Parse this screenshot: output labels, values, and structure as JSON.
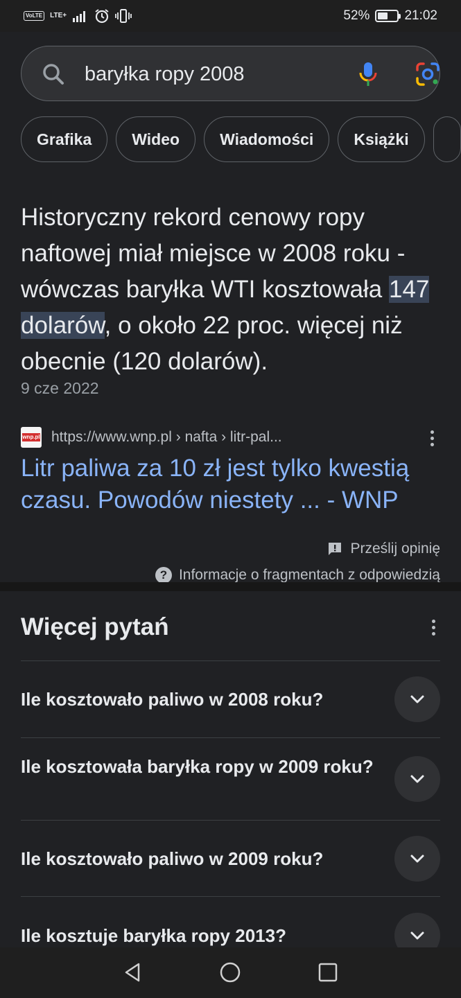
{
  "status_bar": {
    "volte": "VoLTE",
    "network": "LTE+",
    "battery_percent": "52%",
    "battery_level": 0.52,
    "time": "21:02"
  },
  "search": {
    "query": "baryłka ropy 2008",
    "icons": {
      "search": "search-icon",
      "mic": "mic-icon",
      "lens": "google-lens-icon"
    }
  },
  "chips": [
    "Grafika",
    "Wideo",
    "Wiadomości",
    "Książki"
  ],
  "snippet": {
    "answer_before": "Historyczny rekord cenowy ropy naftowej miał miejsce w 2008 roku - wówczas baryłka WTI kosztowała ",
    "answer_highlight": "147 dolarów",
    "answer_after": ", o około 22 proc. więcej niż obecnie (120 dolarów).",
    "date": "9 cze 2022",
    "favicon_text": "wnp.pl",
    "source_url": "https://www.wnp.pl › nafta › litr-pal...",
    "title": "Litr paliwa za 10 zł jest tylko kwestią czasu. Powodów niestety ... - WNP",
    "feedback": "Prześlij opinię",
    "info": "Informacje o fragmentach z odpowiedzią"
  },
  "paa": {
    "title": "Więcej pytań",
    "questions": [
      "Ile kosztowało paliwo w 2008 roku?",
      "Ile kosztowała baryłka ropy w 2009 roku?",
      "Ile kosztowało paliwo w 2009 roku?",
      "Ile kosztuje baryłka ropy 2013?"
    ]
  },
  "colors": {
    "background": "#202124",
    "link": "#8ab4f8",
    "highlight": "#394457",
    "text": "#e8eaed"
  }
}
